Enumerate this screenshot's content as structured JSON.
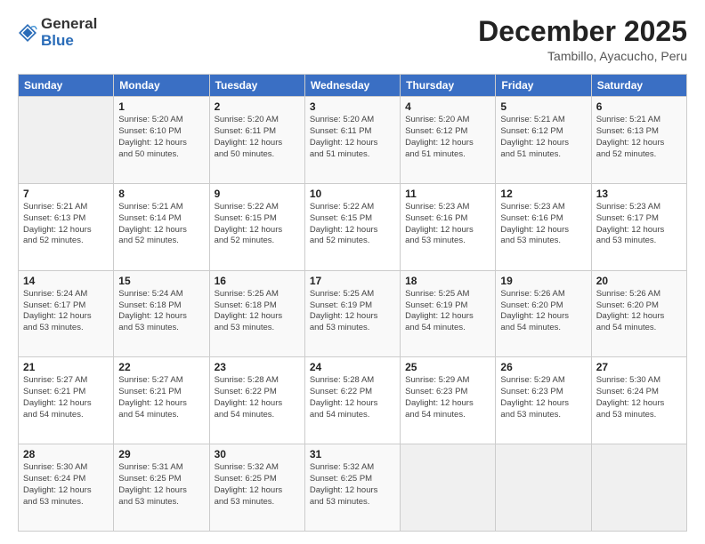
{
  "header": {
    "logo_general": "General",
    "logo_blue": "Blue",
    "month_title": "December 2025",
    "location": "Tambillo, Ayacucho, Peru"
  },
  "days_of_week": [
    "Sunday",
    "Monday",
    "Tuesday",
    "Wednesday",
    "Thursday",
    "Friday",
    "Saturday"
  ],
  "weeks": [
    [
      {
        "day": "",
        "info": ""
      },
      {
        "day": "1",
        "info": "Sunrise: 5:20 AM\nSunset: 6:10 PM\nDaylight: 12 hours\nand 50 minutes."
      },
      {
        "day": "2",
        "info": "Sunrise: 5:20 AM\nSunset: 6:11 PM\nDaylight: 12 hours\nand 50 minutes."
      },
      {
        "day": "3",
        "info": "Sunrise: 5:20 AM\nSunset: 6:11 PM\nDaylight: 12 hours\nand 51 minutes."
      },
      {
        "day": "4",
        "info": "Sunrise: 5:20 AM\nSunset: 6:12 PM\nDaylight: 12 hours\nand 51 minutes."
      },
      {
        "day": "5",
        "info": "Sunrise: 5:21 AM\nSunset: 6:12 PM\nDaylight: 12 hours\nand 51 minutes."
      },
      {
        "day": "6",
        "info": "Sunrise: 5:21 AM\nSunset: 6:13 PM\nDaylight: 12 hours\nand 52 minutes."
      }
    ],
    [
      {
        "day": "7",
        "info": "Sunrise: 5:21 AM\nSunset: 6:13 PM\nDaylight: 12 hours\nand 52 minutes."
      },
      {
        "day": "8",
        "info": "Sunrise: 5:21 AM\nSunset: 6:14 PM\nDaylight: 12 hours\nand 52 minutes."
      },
      {
        "day": "9",
        "info": "Sunrise: 5:22 AM\nSunset: 6:15 PM\nDaylight: 12 hours\nand 52 minutes."
      },
      {
        "day": "10",
        "info": "Sunrise: 5:22 AM\nSunset: 6:15 PM\nDaylight: 12 hours\nand 52 minutes."
      },
      {
        "day": "11",
        "info": "Sunrise: 5:23 AM\nSunset: 6:16 PM\nDaylight: 12 hours\nand 53 minutes."
      },
      {
        "day": "12",
        "info": "Sunrise: 5:23 AM\nSunset: 6:16 PM\nDaylight: 12 hours\nand 53 minutes."
      },
      {
        "day": "13",
        "info": "Sunrise: 5:23 AM\nSunset: 6:17 PM\nDaylight: 12 hours\nand 53 minutes."
      }
    ],
    [
      {
        "day": "14",
        "info": "Sunrise: 5:24 AM\nSunset: 6:17 PM\nDaylight: 12 hours\nand 53 minutes."
      },
      {
        "day": "15",
        "info": "Sunrise: 5:24 AM\nSunset: 6:18 PM\nDaylight: 12 hours\nand 53 minutes."
      },
      {
        "day": "16",
        "info": "Sunrise: 5:25 AM\nSunset: 6:18 PM\nDaylight: 12 hours\nand 53 minutes."
      },
      {
        "day": "17",
        "info": "Sunrise: 5:25 AM\nSunset: 6:19 PM\nDaylight: 12 hours\nand 53 minutes."
      },
      {
        "day": "18",
        "info": "Sunrise: 5:25 AM\nSunset: 6:19 PM\nDaylight: 12 hours\nand 54 minutes."
      },
      {
        "day": "19",
        "info": "Sunrise: 5:26 AM\nSunset: 6:20 PM\nDaylight: 12 hours\nand 54 minutes."
      },
      {
        "day": "20",
        "info": "Sunrise: 5:26 AM\nSunset: 6:20 PM\nDaylight: 12 hours\nand 54 minutes."
      }
    ],
    [
      {
        "day": "21",
        "info": "Sunrise: 5:27 AM\nSunset: 6:21 PM\nDaylight: 12 hours\nand 54 minutes."
      },
      {
        "day": "22",
        "info": "Sunrise: 5:27 AM\nSunset: 6:21 PM\nDaylight: 12 hours\nand 54 minutes."
      },
      {
        "day": "23",
        "info": "Sunrise: 5:28 AM\nSunset: 6:22 PM\nDaylight: 12 hours\nand 54 minutes."
      },
      {
        "day": "24",
        "info": "Sunrise: 5:28 AM\nSunset: 6:22 PM\nDaylight: 12 hours\nand 54 minutes."
      },
      {
        "day": "25",
        "info": "Sunrise: 5:29 AM\nSunset: 6:23 PM\nDaylight: 12 hours\nand 54 minutes."
      },
      {
        "day": "26",
        "info": "Sunrise: 5:29 AM\nSunset: 6:23 PM\nDaylight: 12 hours\nand 53 minutes."
      },
      {
        "day": "27",
        "info": "Sunrise: 5:30 AM\nSunset: 6:24 PM\nDaylight: 12 hours\nand 53 minutes."
      }
    ],
    [
      {
        "day": "28",
        "info": "Sunrise: 5:30 AM\nSunset: 6:24 PM\nDaylight: 12 hours\nand 53 minutes."
      },
      {
        "day": "29",
        "info": "Sunrise: 5:31 AM\nSunset: 6:25 PM\nDaylight: 12 hours\nand 53 minutes."
      },
      {
        "day": "30",
        "info": "Sunrise: 5:32 AM\nSunset: 6:25 PM\nDaylight: 12 hours\nand 53 minutes."
      },
      {
        "day": "31",
        "info": "Sunrise: 5:32 AM\nSunset: 6:25 PM\nDaylight: 12 hours\nand 53 minutes."
      },
      {
        "day": "",
        "info": ""
      },
      {
        "day": "",
        "info": ""
      },
      {
        "day": "",
        "info": ""
      }
    ]
  ]
}
